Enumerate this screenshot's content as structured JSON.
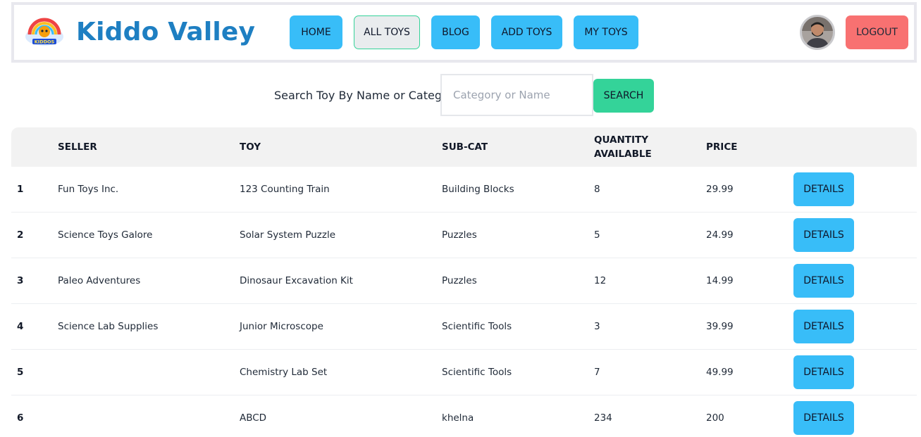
{
  "brand": {
    "name": "Kiddo Valley",
    "logo_text": "KIDDOS"
  },
  "nav": {
    "items": [
      {
        "label": "HOME"
      },
      {
        "label": "ALL TOYS"
      },
      {
        "label": "BLOG"
      },
      {
        "label": "ADD TOYS"
      },
      {
        "label": "MY TOYS"
      }
    ],
    "active_index": 1,
    "logout_label": "LOGOUT"
  },
  "search": {
    "label": "Search Toy By Name or Category",
    "placeholder": "Category or Name",
    "value": "",
    "button_label": "SEARCH"
  },
  "table": {
    "headers": {
      "seller": "SELLER",
      "toy": "TOY",
      "subcat": "SUB-CAT",
      "quantity_line1": "QUANTITY",
      "quantity_line2": "AVAILABLE",
      "price": "PRICE"
    },
    "details_label": "DETAILS",
    "rows": [
      {
        "idx": "1",
        "seller": "Fun Toys Inc.",
        "toy": "123 Counting Train",
        "subcat": "Building Blocks",
        "quantity": "8",
        "price": "29.99"
      },
      {
        "idx": "2",
        "seller": "Science Toys Galore",
        "toy": "Solar System Puzzle",
        "subcat": "Puzzles",
        "quantity": "5",
        "price": "24.99"
      },
      {
        "idx": "3",
        "seller": "Paleo Adventures",
        "toy": "Dinosaur Excavation Kit",
        "subcat": "Puzzles",
        "quantity": "12",
        "price": "14.99"
      },
      {
        "idx": "4",
        "seller": "Science Lab Supplies",
        "toy": "Junior Microscope",
        "subcat": "Scientific Tools",
        "quantity": "3",
        "price": "39.99"
      },
      {
        "idx": "5",
        "seller": "",
        "toy": "Chemistry Lab Set",
        "subcat": "Scientific Tools",
        "quantity": "7",
        "price": "49.99"
      },
      {
        "idx": "6",
        "seller": "",
        "toy": "ABCD",
        "subcat": "khelna",
        "quantity": "234",
        "price": "200"
      }
    ]
  },
  "colors": {
    "brand": "#1e7fc2",
    "nav_button": "#38bdf8",
    "active_border": "#34d399",
    "logout": "#f87171",
    "search_button": "#34d399"
  }
}
